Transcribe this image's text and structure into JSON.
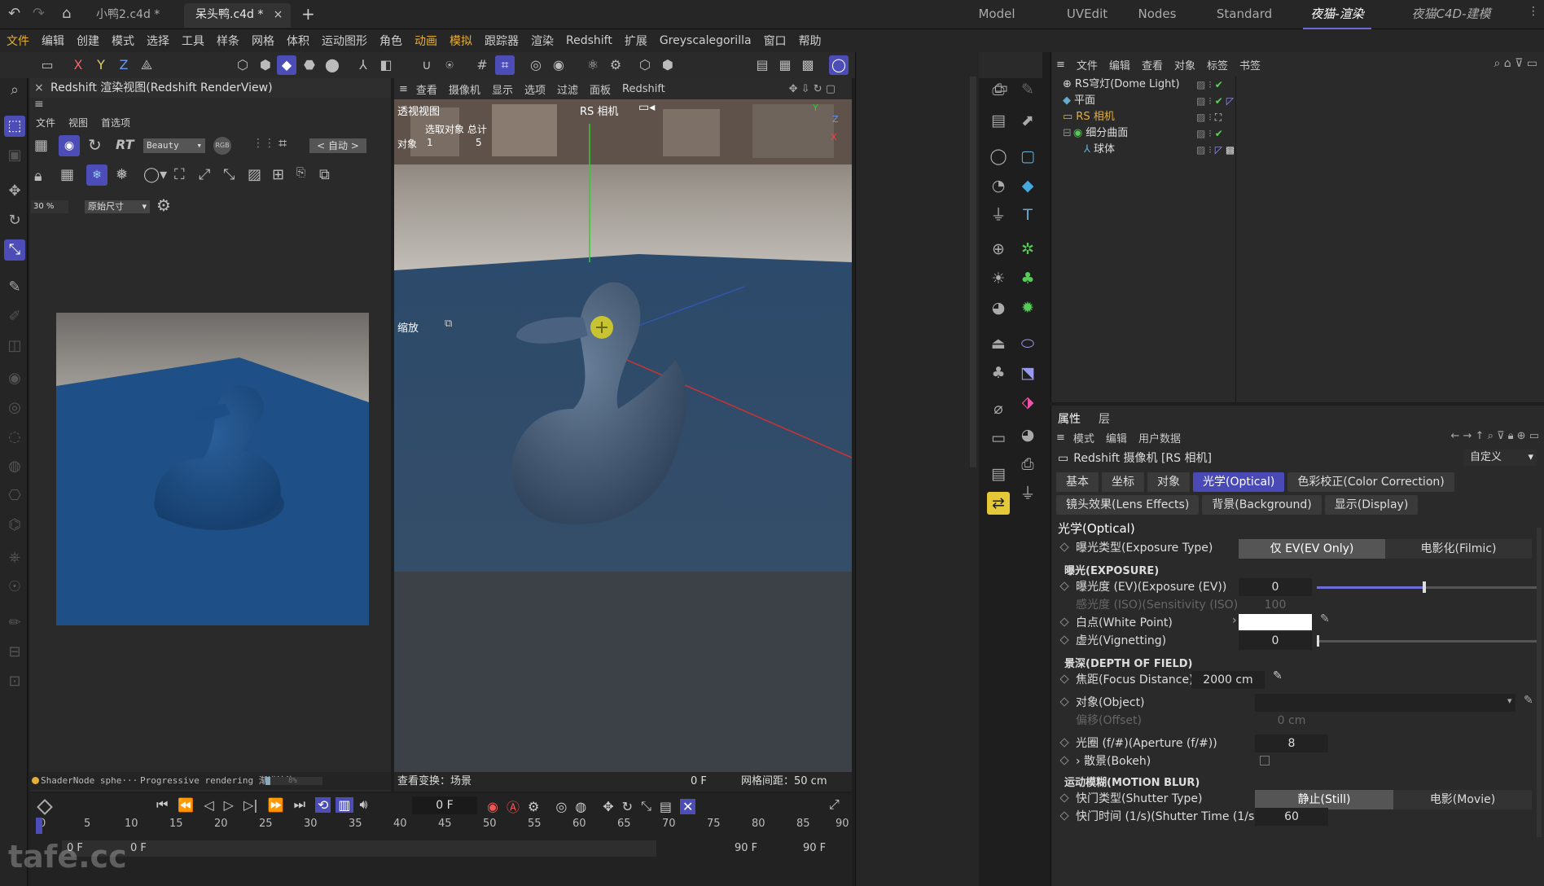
{
  "tabs": {
    "doc1": "小鸭2.c4d *",
    "doc2": "呆头鸭.c4d *"
  },
  "layouts": [
    "Model",
    "UVEdit",
    "Nodes",
    "Standard",
    "夜猫-渲染",
    "夜猫C4D-建模"
  ],
  "menubar": [
    "文件",
    "编辑",
    "创建",
    "模式",
    "选择",
    "工具",
    "样条",
    "网格",
    "体积",
    "运动图形",
    "角色",
    "动画",
    "模拟",
    "跟踪器",
    "渲染",
    "Redshift",
    "扩展",
    "Greyscalegorilla",
    "窗口",
    "帮助"
  ],
  "renderview": {
    "title": "Redshift 渲染视图(Redshift RenderView)",
    "menu": [
      "文件",
      "视图",
      "首选项"
    ],
    "beauty": "Beauty",
    "rt": "RT",
    "auto": "< 自动 >",
    "zoom": "30 %",
    "size": "原始尺寸",
    "status_left": "ShaderNode sphe···",
    "status_mid": "Progressive rendering 渐进渲染",
    "progress_label": "8%",
    "progress": 0.08
  },
  "viewport": {
    "menu": [
      "查看",
      "摄像机",
      "显示",
      "选项",
      "过滤",
      "面板",
      "Redshift"
    ],
    "view_name": "透视视图",
    "camera_name": "RS 相机",
    "hud_header": "选取对象 总计",
    "hud_row_label": "对象",
    "hud_selected": "1",
    "hud_total": "5",
    "zoom_label": "缩放",
    "axis_y": "Y",
    "axis_z": "Z",
    "axis_x": "X",
    "footer_left": "查看变换：场景",
    "footer_frame": "0 F",
    "footer_grid": "网格间距：50 cm"
  },
  "timeline": {
    "frame_field": "0 F",
    "ticks": [
      "0",
      "5",
      "10",
      "15",
      "20",
      "25",
      "30",
      "35",
      "40",
      "45",
      "50",
      "55",
      "60",
      "65",
      "70",
      "75",
      "80",
      "85",
      "90"
    ],
    "start": "0 F",
    "start2": "0 F",
    "end": "90 F",
    "end2": "90 F"
  },
  "watermark": "tafe.cc",
  "objmgr": {
    "menu": [
      "文件",
      "编辑",
      "查看",
      "对象",
      "标签",
      "书签"
    ],
    "objects": [
      {
        "name": "RS穹灯(Dome Light)",
        "indent": 0
      },
      {
        "name": "平面",
        "indent": 0
      },
      {
        "name": "RS 相机",
        "indent": 0
      },
      {
        "name": "细分曲面",
        "indent": 0
      },
      {
        "name": "球体",
        "indent": 1
      }
    ]
  },
  "attr": {
    "tabs": [
      "属性",
      "层"
    ],
    "menu": [
      "模式",
      "编辑",
      "用户数据"
    ],
    "title": "Redshift 摄像机 [RS 相机]",
    "preset": "自定义",
    "ptabs1": [
      "基本",
      "坐标",
      "对象",
      "光学(Optical)",
      "色彩校正(Color Correction)"
    ],
    "ptabs2": [
      "镜头效果(Lens Effects)",
      "背景(Background)",
      "显示(Display)"
    ],
    "section": "光学(Optical)",
    "exposure_type_label": "曝光类型(Exposure Type)",
    "exposure_opt1": "仅 EV(EV Only)",
    "exposure_opt2": "电影化(Filmic)",
    "sec_exposure": "曝光(EXPOSURE)",
    "ev_label": "曝光度 (EV)(Exposure (EV))",
    "ev_value": "0",
    "iso_label": "感光度 (ISO)(Sensitivity (ISO))",
    "iso_value": "100",
    "white_label": "白点(White Point)",
    "vignette_label": "虚光(Vignetting)",
    "vignette_value": "0",
    "sec_dof": "景深(DEPTH OF FIELD)",
    "focus_label": "焦距(Focus Distance)",
    "focus_value": "2000 cm",
    "object_label": "对象(Object)",
    "offset_label": "偏移(Offset)",
    "offset_value": "0 cm",
    "aperture_label": "光圈 (f/#)(Aperture (f/#))",
    "aperture_value": "8",
    "bokeh_label": "› 散景(Bokeh)",
    "sec_motion": "运动模糊(MOTION BLUR)",
    "shutter_type_label": "快门类型(Shutter Type)",
    "shutter_opt1": "静止(Still)",
    "shutter_opt2": "电影(Movie)",
    "shutter_time_label": "快门时间 (1/s)(Shutter Time (1/s))",
    "shutter_time_value": "60"
  },
  "colors": {
    "accent": "#4d4db8",
    "highlight": "#e5b038",
    "check": "#5fd35f"
  }
}
